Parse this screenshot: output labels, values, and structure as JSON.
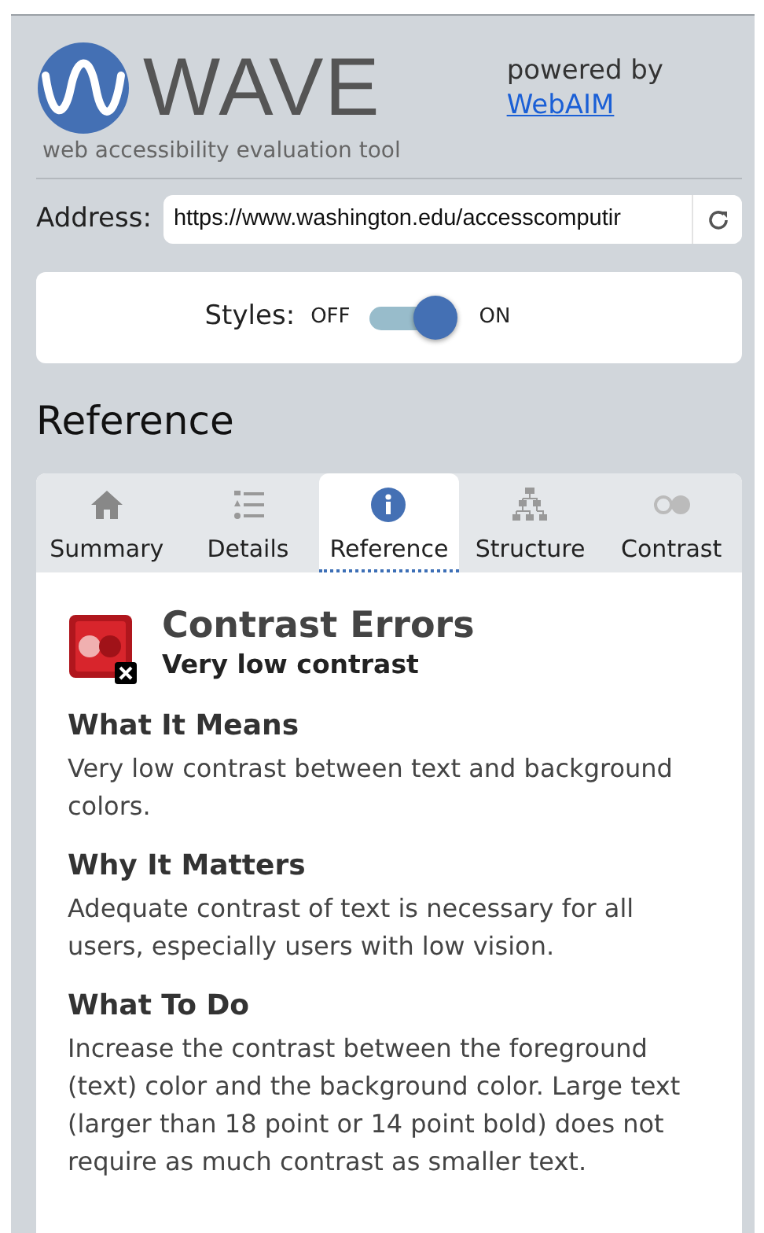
{
  "logo": {
    "name": "WAVE",
    "tagline": "web accessibility evaluation tool"
  },
  "powered_by": {
    "text": "powered by",
    "link": "WebAIM"
  },
  "address": {
    "label": "Address:",
    "value": "https://www.washington.edu/accesscomputir"
  },
  "styles_toggle": {
    "label": "Styles:",
    "off_label": "OFF",
    "on_label": "ON",
    "on": true
  },
  "panel_title": "Reference",
  "tabs": [
    {
      "label": "Summary",
      "selected": false
    },
    {
      "label": "Details",
      "selected": false
    },
    {
      "label": "Reference",
      "selected": true
    },
    {
      "label": "Structure",
      "selected": false
    },
    {
      "label": "Contrast",
      "selected": false
    }
  ],
  "reference": {
    "title": "Contrast Errors",
    "subtitle": "Very low contrast",
    "sections": [
      {
        "heading": "What It Means",
        "text": "Very low contrast between text and background colors."
      },
      {
        "heading": "Why It Matters",
        "text": "Adequate contrast of text is necessary for all users, especially users with low vision."
      },
      {
        "heading": "What To Do",
        "text": "Increase the contrast between the foreground (text) color and the background color. Large text (larger than 18 point or 14 point bold) does not require as much contrast as smaller text."
      }
    ]
  }
}
